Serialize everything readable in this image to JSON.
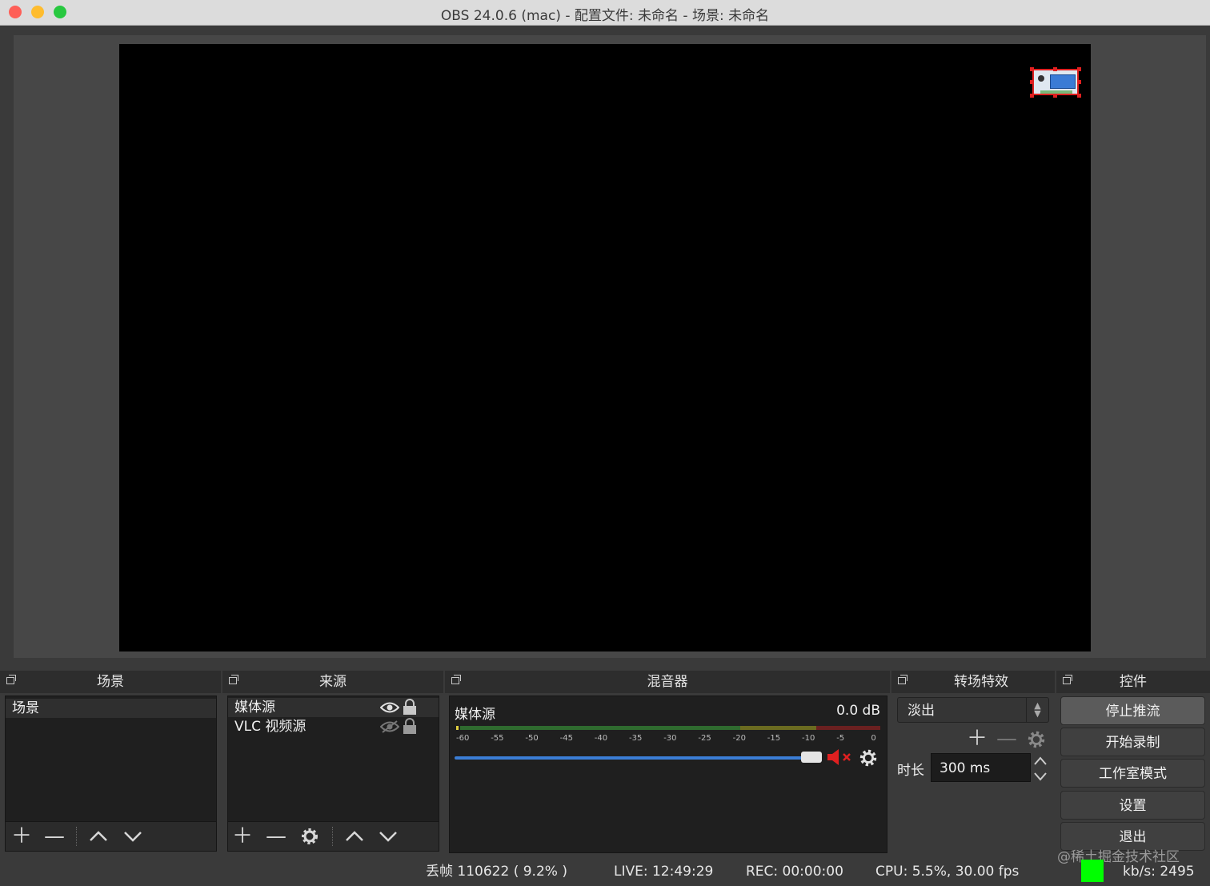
{
  "window": {
    "title": "OBS 24.0.6 (mac) - 配置文件: 未命名 - 场景: 未命名"
  },
  "docks": {
    "scenes": {
      "title": "场景",
      "items": [
        "场景"
      ]
    },
    "sources": {
      "title": "来源",
      "items": [
        {
          "label": "媒体源",
          "visible": true,
          "locked": true
        },
        {
          "label": "VLC 视频源",
          "visible": false,
          "locked": true
        }
      ]
    },
    "mixer": {
      "title": "混音器",
      "channel": {
        "name": "媒体源",
        "level": "0.0 dB",
        "volume_fraction": 1.0,
        "muted": true,
        "ticks": [
          "-60",
          "-55",
          "-50",
          "-45",
          "-40",
          "-35",
          "-30",
          "-25",
          "-20",
          "-15",
          "-10",
          "-5",
          "0"
        ]
      }
    },
    "transitions": {
      "title": "转场特效",
      "selected": "淡出",
      "duration_label": "时长",
      "duration_value": "300 ms"
    },
    "controls": {
      "title": "控件",
      "buttons": [
        "停止推流",
        "开始录制",
        "工作室模式",
        "设置",
        "退出"
      ]
    }
  },
  "status": {
    "dropped": "丢帧 110622 ( 9.2% )",
    "live": "LIVE: 12:49:29",
    "rec": "REC: 00:00:00",
    "cpu": "CPU: 5.5%, 30.00 fps",
    "kbs": "kb/s: 2495",
    "indicator_color": "#00ff00"
  },
  "watermark": "@稀土掘金技术社区",
  "colors": {
    "accent": "#3b7ed6",
    "mute": "#e02020",
    "selection": "#e02020"
  }
}
